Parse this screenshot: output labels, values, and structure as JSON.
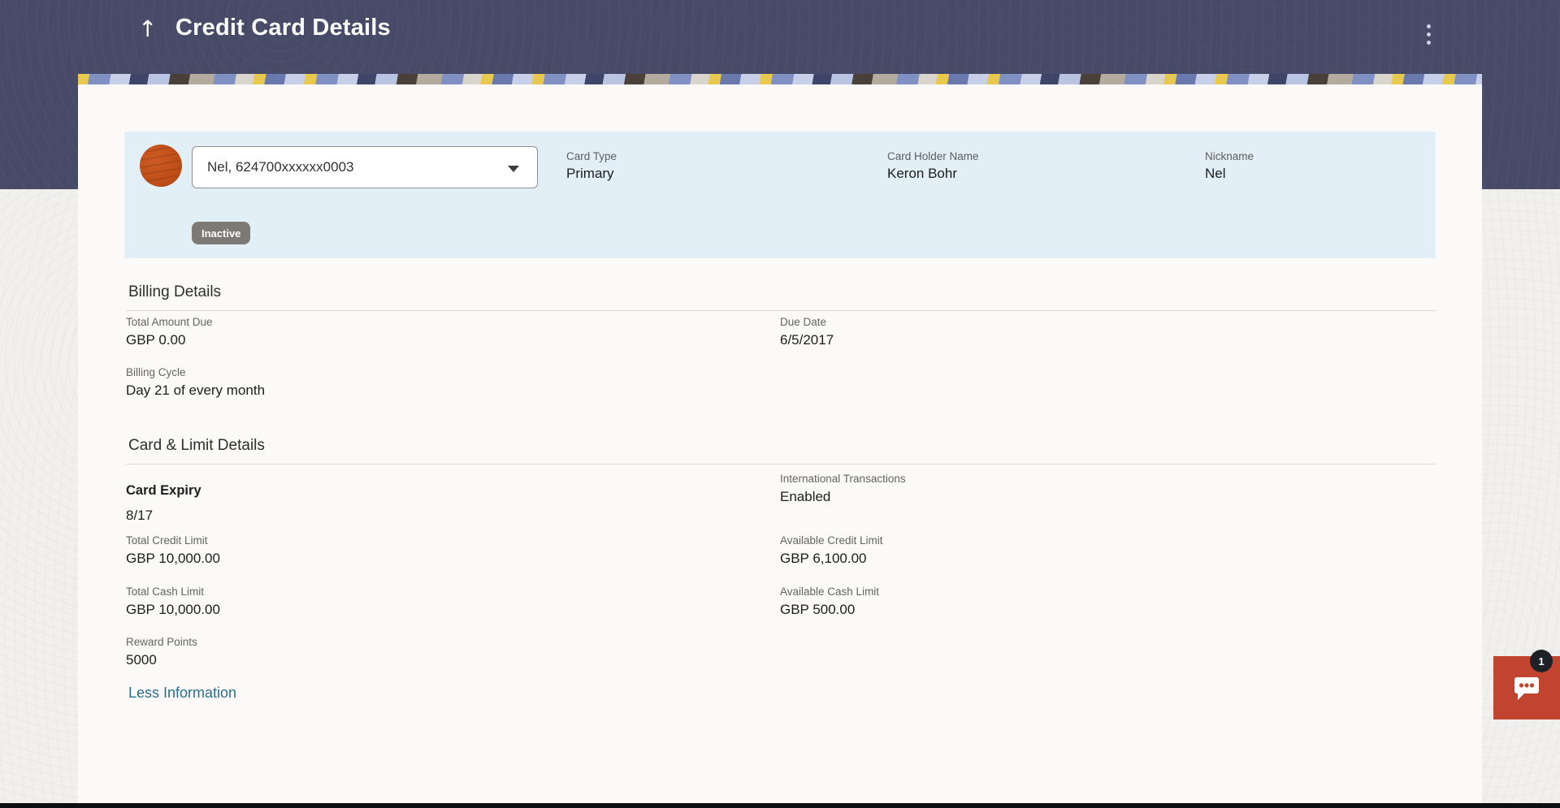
{
  "colors": {
    "header_bg": "#474b68",
    "page_bg": "#f1f0ee",
    "card_bg": "#fbfaf8",
    "summary_panel_bg": "#e2eff7",
    "avatar_orange": "#bf4c1d",
    "status_badge_bg": "#7d7a75",
    "link_teal": "#2b6e8f",
    "chat_red": "#c1452e",
    "chat_badge_bg": "#1e2125"
  },
  "header": {
    "back_icon": "↑",
    "title": "Credit Card Details"
  },
  "card_summary": {
    "selector_value": "Nel, 624700xxxxxx0003",
    "status": "Inactive",
    "fields": [
      {
        "label": "Card Type",
        "value": "Primary"
      },
      {
        "label": "Card Holder Name",
        "value": "Keron Bohr"
      },
      {
        "label": "Nickname",
        "value": "Nel"
      }
    ]
  },
  "billing_details": {
    "heading": "Billing Details",
    "total_amount_due": {
      "label": "Total Amount Due",
      "value": "GBP 0.00"
    },
    "due_date": {
      "label": "Due Date",
      "value": "6/5/2017"
    },
    "billing_cycle": {
      "label": "Billing Cycle",
      "value": "Day 21 of every month"
    }
  },
  "card_limit_details": {
    "heading": "Card & Limit Details",
    "card_expiry": {
      "label": "Card Expiry",
      "value": "8/17"
    },
    "international_transactions": {
      "label": "International Transactions",
      "value": "Enabled"
    },
    "total_credit_limit": {
      "label": "Total Credit Limit",
      "value": "GBP 10,000.00"
    },
    "available_credit_limit": {
      "label": "Available Credit Limit",
      "value": "GBP 6,100.00"
    },
    "total_cash_limit": {
      "label": "Total Cash Limit",
      "value": "GBP 10,000.00"
    },
    "available_cash_limit": {
      "label": "Available Cash Limit",
      "value": "GBP 500.00"
    },
    "reward_points": {
      "label": "Reward Points",
      "value": "5000"
    }
  },
  "footer_link": {
    "label": "Less Information"
  },
  "chat": {
    "unread_count": "1"
  }
}
